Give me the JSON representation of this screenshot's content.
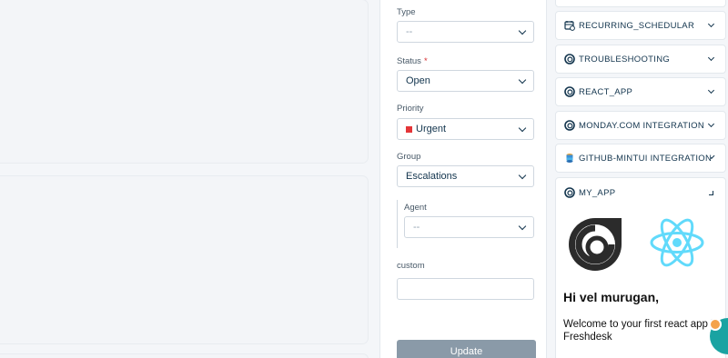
{
  "form": {
    "type": {
      "label": "Type",
      "value": "--"
    },
    "status": {
      "label": "Status",
      "required_mark": "*",
      "value": "Open"
    },
    "priority": {
      "label": "Priority",
      "value": "Urgent",
      "color": "#e43538"
    },
    "group": {
      "label": "Group",
      "value": "Escalations"
    },
    "agent": {
      "label": "Agent",
      "value": "--"
    },
    "custom": {
      "label": "custom",
      "value": ""
    },
    "update_label": "Update"
  },
  "apps": [
    {
      "label": "RECURRING_SCHEDULAR",
      "icon": "calendar-sync-icon"
    },
    {
      "label": "TROUBLESHOOTING",
      "icon": "freshdesk-icon"
    },
    {
      "label": "REACT_APP",
      "icon": "freshdesk-icon"
    },
    {
      "label": "MONDAY.COM INTEGRATION",
      "icon": "freshdesk-icon"
    },
    {
      "label": "GITHUB-MINTUI INTEGRATION",
      "icon": "database-icon"
    }
  ],
  "my_app": {
    "label": "MY_APP",
    "greeting": "Hi vel murugan,",
    "welcome": "Welcome to your first react app in Freshdesk"
  },
  "colors": {
    "accent": "#1aa3a2",
    "update_button": "#8a9aa8",
    "react": "#61dafb"
  }
}
